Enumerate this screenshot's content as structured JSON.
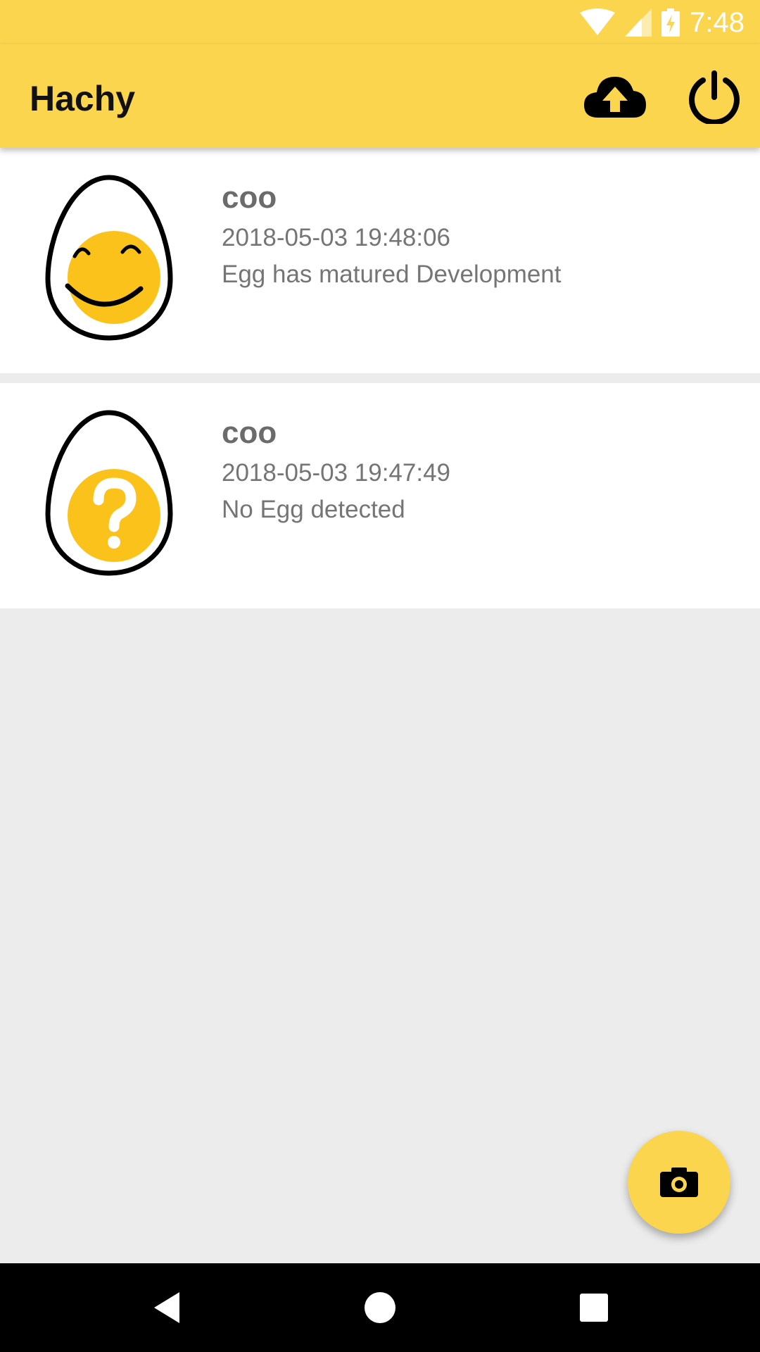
{
  "status_bar": {
    "time": "7:48"
  },
  "app_bar": {
    "title": "Hachy"
  },
  "entries": [
    {
      "name": "coo",
      "timestamp": "2018-05-03 19:48:06",
      "status": "Egg has matured Development",
      "icon": "egg-smile-icon"
    },
    {
      "name": "coo",
      "timestamp": "2018-05-03 19:47:49",
      "status": "No Egg detected",
      "icon": "egg-question-icon"
    }
  ],
  "colors": {
    "accent": "#fbd54e",
    "yolk": "#fbc21b",
    "background": "#ececec"
  }
}
